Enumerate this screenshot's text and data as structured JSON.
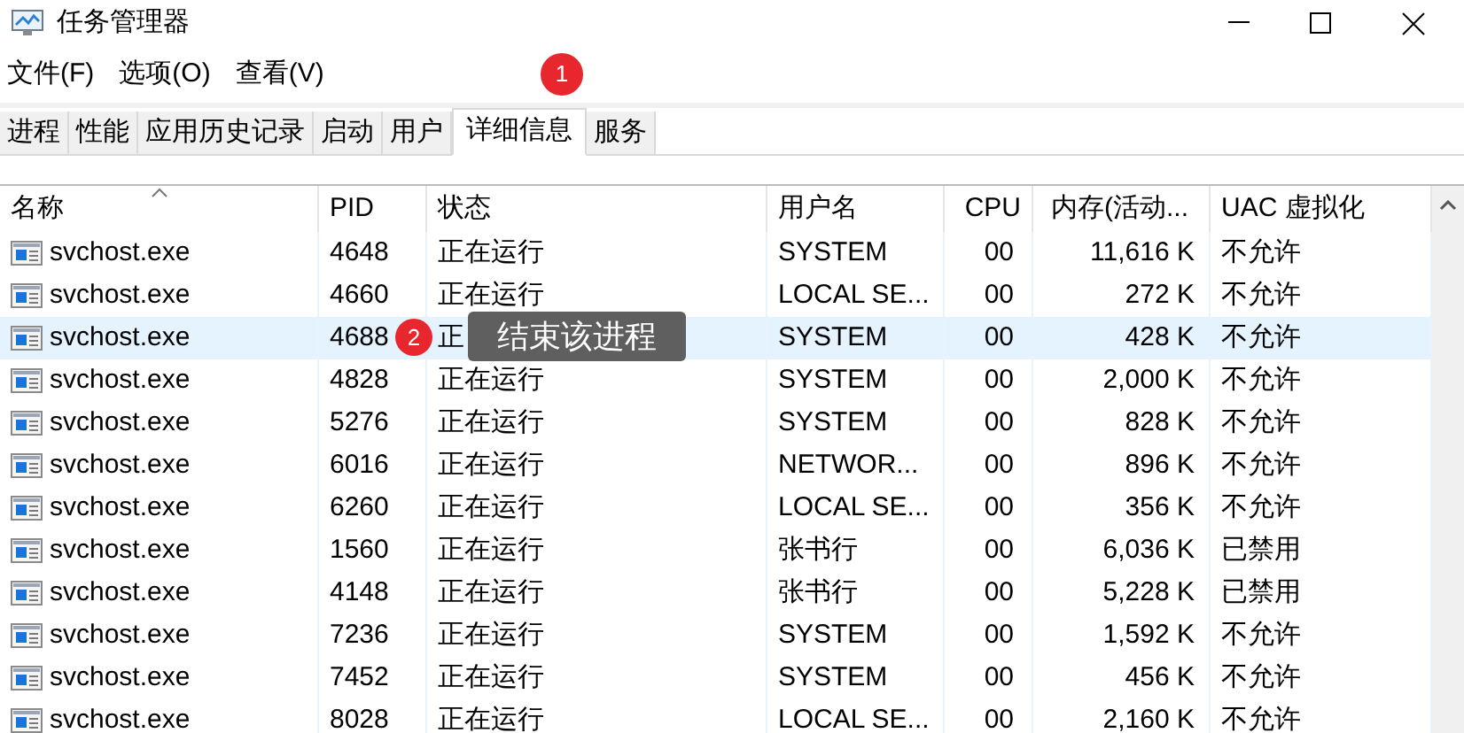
{
  "window": {
    "title": "任务管理器"
  },
  "menu": [
    "文件(F)",
    "选项(O)",
    "查看(V)"
  ],
  "tabs": [
    {
      "label": "进程",
      "selected": false
    },
    {
      "label": "性能",
      "selected": false
    },
    {
      "label": "应用历史记录",
      "selected": false
    },
    {
      "label": "启动",
      "selected": false
    },
    {
      "label": "用户",
      "selected": false
    },
    {
      "label": "详细信息",
      "selected": true
    },
    {
      "label": "服务",
      "selected": false
    }
  ],
  "table": {
    "columns": [
      {
        "label": "名称",
        "sorted": true
      },
      {
        "label": "PID",
        "sorted": false
      },
      {
        "label": "状态",
        "sorted": false
      },
      {
        "label": "用户名",
        "sorted": false
      },
      {
        "label": "CPU",
        "sorted": false
      },
      {
        "label": "内存(活动...",
        "sorted": false
      },
      {
        "label": "UAC 虚拟化",
        "sorted": false
      }
    ],
    "rows": [
      {
        "name": "svchost.exe",
        "pid": "4648",
        "status": "正在运行",
        "user": "SYSTEM",
        "cpu": "00",
        "memory": "11,616 K",
        "uac": "不允许",
        "selected": false
      },
      {
        "name": "svchost.exe",
        "pid": "4660",
        "status": "正在运行",
        "user": "LOCAL SE...",
        "cpu": "00",
        "memory": "272 K",
        "uac": "不允许",
        "selected": false
      },
      {
        "name": "svchost.exe",
        "pid": "4688",
        "status": "正",
        "user": "SYSTEM",
        "cpu": "00",
        "memory": "428 K",
        "uac": "不允许",
        "selected": true
      },
      {
        "name": "svchost.exe",
        "pid": "4828",
        "status": "正在运行",
        "user": "SYSTEM",
        "cpu": "00",
        "memory": "2,000 K",
        "uac": "不允许",
        "selected": false
      },
      {
        "name": "svchost.exe",
        "pid": "5276",
        "status": "正在运行",
        "user": "SYSTEM",
        "cpu": "00",
        "memory": "828 K",
        "uac": "不允许",
        "selected": false
      },
      {
        "name": "svchost.exe",
        "pid": "6016",
        "status": "正在运行",
        "user": "NETWOR...",
        "cpu": "00",
        "memory": "896 K",
        "uac": "不允许",
        "selected": false
      },
      {
        "name": "svchost.exe",
        "pid": "6260",
        "status": "正在运行",
        "user": "LOCAL SE...",
        "cpu": "00",
        "memory": "356 K",
        "uac": "不允许",
        "selected": false
      },
      {
        "name": "svchost.exe",
        "pid": "1560",
        "status": "正在运行",
        "user": "张书行",
        "cpu": "00",
        "memory": "6,036 K",
        "uac": "已禁用",
        "selected": false
      },
      {
        "name": "svchost.exe",
        "pid": "4148",
        "status": "正在运行",
        "user": "张书行",
        "cpu": "00",
        "memory": "5,228 K",
        "uac": "已禁用",
        "selected": false
      },
      {
        "name": "svchost.exe",
        "pid": "7236",
        "status": "正在运行",
        "user": "SYSTEM",
        "cpu": "00",
        "memory": "1,592 K",
        "uac": "不允许",
        "selected": false
      },
      {
        "name": "svchost.exe",
        "pid": "7452",
        "status": "正在运行",
        "user": "SYSTEM",
        "cpu": "00",
        "memory": "456 K",
        "uac": "不允许",
        "selected": false
      },
      {
        "name": "svchost.exe",
        "pid": "8028",
        "status": "正在运行",
        "user": "LOCAL SE...",
        "cpu": "00",
        "memory": "2,160 K",
        "uac": "不允许",
        "selected": false
      }
    ]
  },
  "annotations": [
    {
      "label": "1"
    },
    {
      "label": "2"
    }
  ],
  "tooltip": {
    "text": "结束该进程"
  }
}
